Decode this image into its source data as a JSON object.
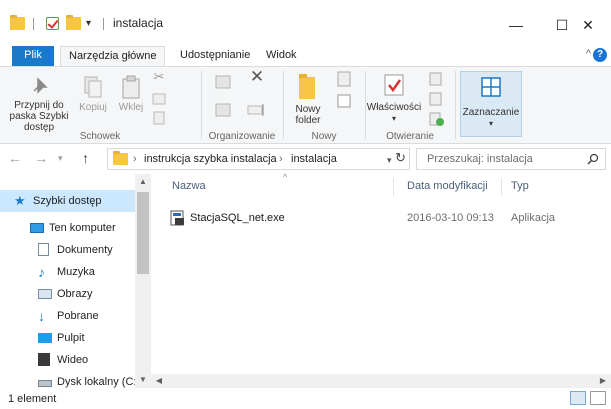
{
  "window": {
    "title": "instalacja",
    "minimize_glyph": "—",
    "maximize_glyph": "☐",
    "close_glyph": "✕"
  },
  "quick_access_toolbar": {
    "dropdown_glyph": "▾",
    "icons": [
      "folder-icon",
      "properties-check-icon",
      "new-folder-icon"
    ]
  },
  "ribbon_tabs": [
    {
      "label": "Plik"
    },
    {
      "label": "Narzędzia główne"
    },
    {
      "label": "Udostępnianie"
    },
    {
      "label": "Widok"
    }
  ],
  "ribbon_help": "?",
  "ribbon": {
    "clipboard": {
      "pin_label": "Przypnij do paska Szybki dostęp",
      "copy_label": "Kopiuj",
      "paste_label": "Wklej",
      "group_label": "Schowek"
    },
    "organize": {
      "group_label": "Organizowanie"
    },
    "new": {
      "new_folder_label": "Nowy folder",
      "group_label": "Nowy"
    },
    "open": {
      "properties_label": "Właściwości",
      "group_label": "Otwieranie"
    },
    "select": {
      "select_label": "Zaznaczanie"
    }
  },
  "address_bar": {
    "breadcrumb": [
      "instrukcja szybka instalacja",
      "instalacja"
    ],
    "separator": "›",
    "search_placeholder": "Przeszukaj: instalacja"
  },
  "nav_pane": {
    "items": [
      {
        "label": "Szybki dostęp",
        "icon": "star-icon"
      },
      {
        "label": "Ten komputer",
        "icon": "computer-icon"
      },
      {
        "label": "Dokumenty",
        "icon": "documents-icon"
      },
      {
        "label": "Muzyka",
        "icon": "music-icon"
      },
      {
        "label": "Obrazy",
        "icon": "pictures-icon"
      },
      {
        "label": "Pobrane",
        "icon": "downloads-icon"
      },
      {
        "label": "Pulpit",
        "icon": "desktop-icon"
      },
      {
        "label": "Wideo",
        "icon": "video-icon"
      },
      {
        "label": "Dysk lokalny (C:)",
        "icon": "drive-icon"
      }
    ]
  },
  "file_list": {
    "columns": {
      "name": "Nazwa",
      "date": "Data modyfikacji",
      "type": "Typ"
    },
    "rows": [
      {
        "name": "StacjaSQL_net.exe",
        "date": "2016-03-10 09:13",
        "type": "Aplikacja",
        "icon": "installer-app-icon"
      }
    ]
  },
  "status": {
    "count": "1 element"
  },
  "colors": {
    "accent": "#1979ca",
    "selection": "#cce8ff",
    "folder": "#f7c743"
  }
}
